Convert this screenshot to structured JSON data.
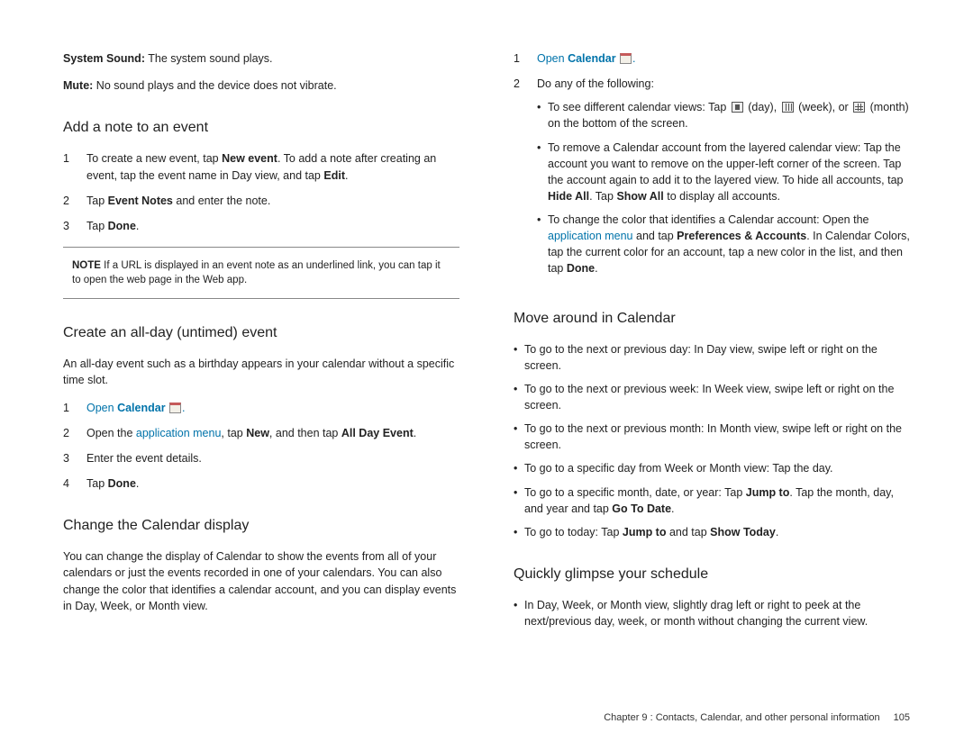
{
  "left": {
    "intro": {
      "sys_label": "System Sound:",
      "sys_text": " The system sound plays.",
      "mute_label": "Mute:",
      "mute_text": " No sound plays and the device does not vibrate."
    },
    "sec1": {
      "title": "Add a note to an event",
      "s1a": "To create a new event, tap ",
      "s1b": "New event",
      "s1c": ". To add a note after creating an event, tap the event name in Day view, and tap ",
      "s1d": "Edit",
      "s1e": ".",
      "s2a": "Tap ",
      "s2b": "Event Notes",
      "s2c": " and enter the note.",
      "s3a": "Tap ",
      "s3b": "Done",
      "s3c": ".",
      "note_label": "NOTE",
      "note_text": "  If a URL is displayed in an event note as an underlined link, you can tap it to open the web page in the Web app."
    },
    "sec2": {
      "title": "Create an all-day (untimed) event",
      "intro": "An all-day event such as a birthday appears in your calendar without a specific time slot.",
      "s1a": "Open ",
      "s1b": "Calendar",
      "s1d": ".",
      "s2a": "Open the ",
      "s2b": "application menu",
      "s2c": ", tap ",
      "s2d": "New",
      "s2e": ", and then tap ",
      "s2f": "All Day Event",
      "s2g": ".",
      "s3": "Enter the event details.",
      "s4a": "Tap ",
      "s4b": "Done",
      "s4c": "."
    },
    "sec3": {
      "title": "Change the Calendar display",
      "intro": "You can change the display of Calendar to show the events from all of your calendars or just the events recorded in one of your calendars. You can also change the color that identifies a calendar account, and you can display events in Day, Week, or Month view."
    }
  },
  "right": {
    "open": {
      "s1a": "Open ",
      "s1b": "Calendar",
      "s1d": ".",
      "s2": "Do any of the following:",
      "b1a": "To see different calendar views: Tap ",
      "b1b": " (day), ",
      "b1c": " (week), or ",
      "b1d": " (month) on the bottom of the screen.",
      "b2a": "To remove a Calendar account from the layered calendar view: Tap the account you want to remove on the upper-left corner of the screen. Tap the account again to add it to the layered view. To hide all accounts, tap ",
      "b2b": "Hide All",
      "b2c": ". Tap ",
      "b2d": "Show All",
      "b2e": " to display all accounts.",
      "b3a": "To change the color that identifies a Calendar account: Open the ",
      "b3b": "application menu",
      "b3c": " and tap ",
      "b3d": "Preferences & Accounts",
      "b3e": ". In Calendar Colors, tap the current color for an account, tap a new color in the list, and then tap ",
      "b3f": "Done",
      "b3g": "."
    },
    "sec4": {
      "title": "Move around in Calendar",
      "b1": "To go to the next or previous day: In Day view, swipe left or right on the screen.",
      "b2": "To go to the next or previous week: In Week view, swipe left or right on the screen.",
      "b3": "To go to the next or previous month: In Month view, swipe left or right on the screen.",
      "b4": "To go to a specific day from Week or Month view: Tap the day.",
      "b5a": "To go to a specific month, date, or year: Tap ",
      "b5b": "Jump to",
      "b5c": ". Tap the month, day, and year and tap ",
      "b5d": "Go To Date",
      "b5e": ".",
      "b6a": "To go to today: Tap ",
      "b6b": "Jump to",
      "b6c": " and tap ",
      "b6d": "Show Today",
      "b6e": "."
    },
    "sec5": {
      "title": "Quickly glimpse your schedule",
      "b1": "In Day, Week, or Month view, slightly drag left or right to peek at the next/previous day, week, or month without changing the current view."
    }
  },
  "footer": {
    "chapter": "Chapter 9 :  Contacts, Calendar, and other personal information",
    "page": "105"
  }
}
